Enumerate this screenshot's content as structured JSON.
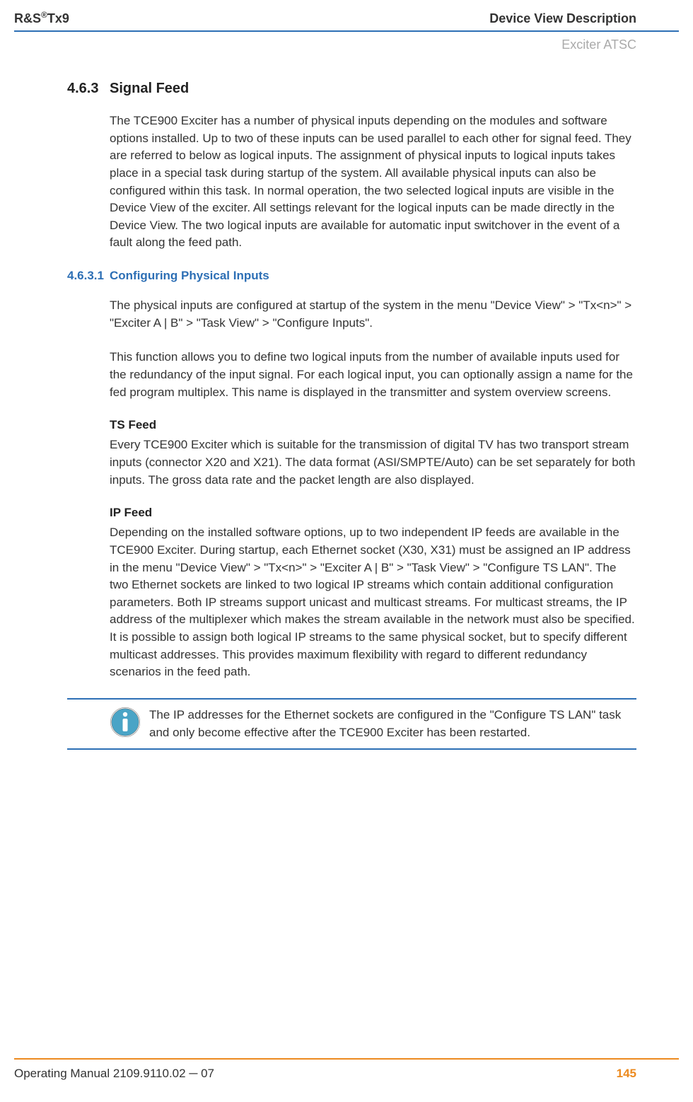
{
  "header": {
    "product": "R&S®Tx9",
    "chapter": "Device View Description",
    "subheader": "Exciter ATSC"
  },
  "section": {
    "num": "4.6.3",
    "title": "Signal Feed",
    "intro": "The TCE900 Exciter has a number of physical inputs depending on the modules and software options installed. Up to two of these inputs can be used parallel to each other for signal feed. They are referred to below as logical inputs. The assignment of physical inputs to logical inputs takes place in a special task during startup of the system. All available physical inputs can also be configured within this task. In normal operation, the two selected logical inputs are visible in the Device View of the exciter. All settings relevant for the logical inputs can be made directly in the Device View. The two logical inputs are available for automatic input switchover in the event of a fault along the feed path."
  },
  "subsection": {
    "num": "4.6.3.1",
    "title": "Configuring Physical Inputs",
    "p1": "The physical inputs are configured at startup of the system in the menu \"Device View\" > \"Tx<n>\" > \"Exciter A | B\" > \"Task View\" > \"Configure Inputs\".",
    "p2": "This function allows you to define two logical inputs from the number of available inputs used for the redundancy of the input signal. For each logical input, you can optionally assign a name for the fed program multiplex. This name is displayed in the transmitter and system overview screens.",
    "ts_heading": "TS Feed",
    "ts_body": "Every TCE900 Exciter which is suitable for the transmission of digital TV has two transport stream inputs (connector X20 and X21). The data format (ASI/SMPTE/Auto) can be set separately for both inputs. The gross data rate and the packet length are also displayed.",
    "ip_heading": "IP Feed",
    "ip_body": "Depending on the installed software options, up to two independent IP feeds are available in the TCE900 Exciter. During startup, each Ethernet socket (X30, X31) must be assigned an IP address in the menu \"Device View\" > \"Tx<n>\" > \"Exciter A | B\" > \"Task View\" > \"Configure TS LAN\". The two Ethernet sockets are linked to two logical IP streams which contain additional configuration parameters. Both IP streams support unicast and multicast streams. For multicast streams, the IP address of the multiplexer which makes the stream available in the network must also be specified. It is possible to assign both logical IP streams to the same physical socket, but to specify different multicast addresses. This provides maximum flexibility with regard to different redundancy scenarios in the feed path.",
    "note": "The IP addresses for the Ethernet sockets are configured in the \"Configure TS LAN\" task and only become effective after the TCE900 Exciter has been restarted."
  },
  "footer": {
    "left": "Operating Manual 2109.9110.02 ─ 07",
    "page": "145"
  }
}
